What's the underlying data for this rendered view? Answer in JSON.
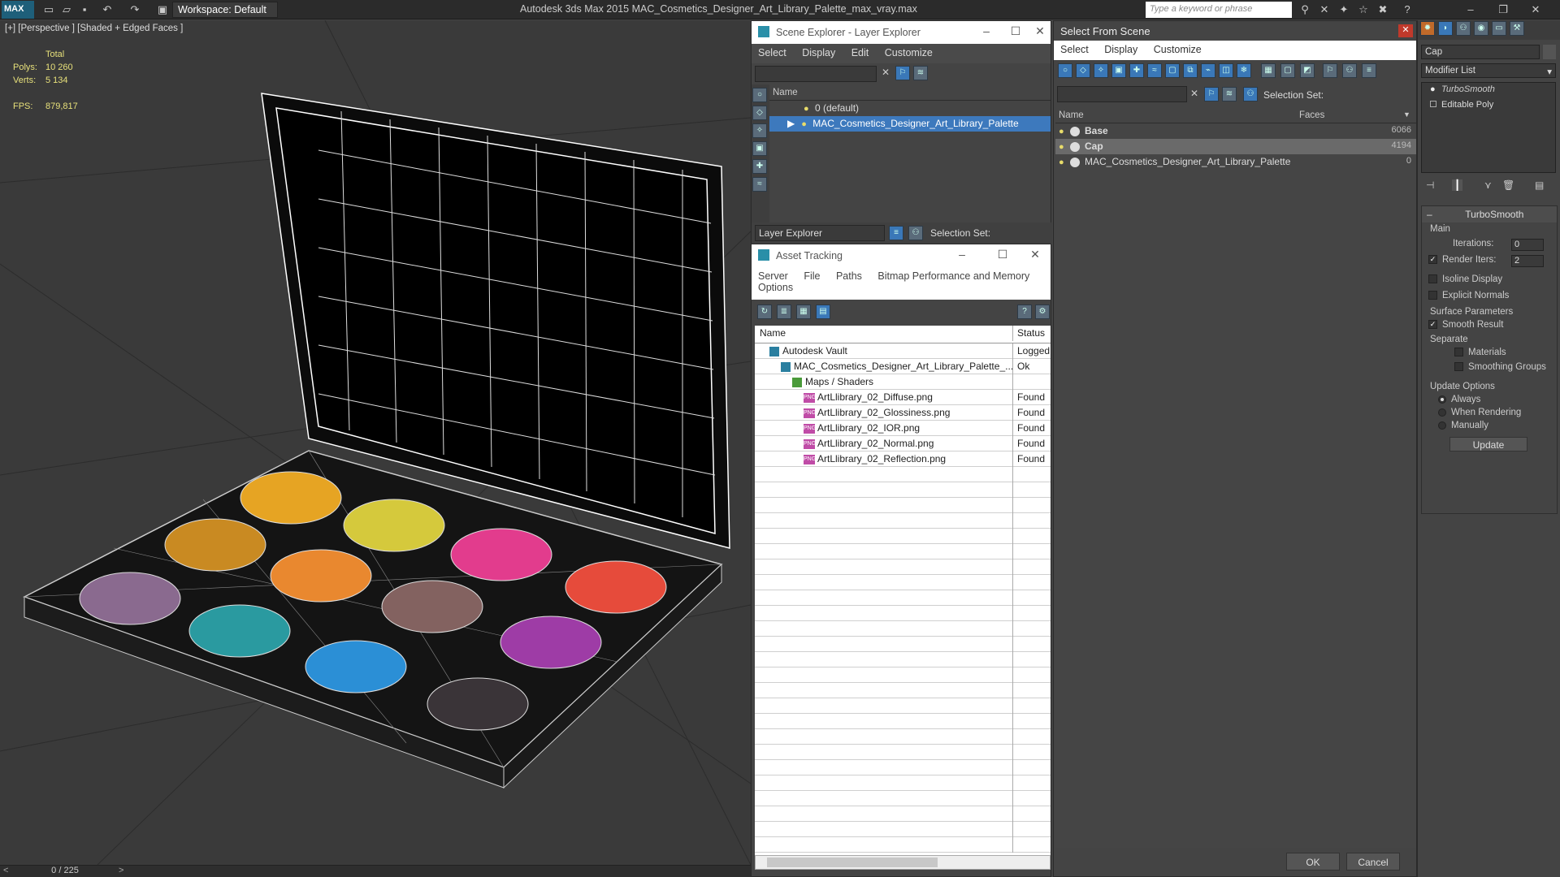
{
  "app": {
    "logo": "MAX",
    "workspace": "Workspace: Default",
    "title": "Autodesk 3ds Max  2015    MAC_Cosmetics_Designer_Art_Library_Palette_max_vray.max",
    "search_placeholder": "Type a keyword or phrase"
  },
  "viewport": {
    "label": "[+] [Perspective ] [Shaded + Edged Faces ]",
    "stats": {
      "total_label": "Total",
      "polys_label": "Polys:",
      "polys": "10 260",
      "verts_label": "Verts:",
      "verts": "5 134",
      "fps_label": "FPS:",
      "fps": "879,817"
    },
    "timeline": "0 / 225",
    "swatches": [
      "#e6a423",
      "#d5c93c",
      "#c98a22",
      "#e9882f",
      "#e23c8d",
      "#e64b3b",
      "#8a6a8f",
      "#2a9aa0",
      "#836260",
      "#9e3ca6",
      "#2b8fd6",
      "#3a3438"
    ]
  },
  "scene_explorer": {
    "title": "Scene Explorer - Layer Explorer",
    "menu": [
      "Select",
      "Display",
      "Edit",
      "Customize"
    ],
    "col_name": "Name",
    "rows": [
      {
        "label": "0 (default)",
        "selected": false
      },
      {
        "label": "MAC_Cosmetics_Designer_Art_Library_Palette",
        "selected": true
      }
    ],
    "footer_dropdown": "Layer Explorer",
    "selection_set": "Selection Set:"
  },
  "asset_tracking": {
    "title": "Asset Tracking",
    "menu": [
      "Server",
      "File",
      "Paths",
      "Bitmap Performance and Memory"
    ],
    "menu2": [
      "Options"
    ],
    "col_name": "Name",
    "col_status": "Status",
    "rows": [
      {
        "name": "Autodesk Vault",
        "status": "Logged",
        "indent": 1
      },
      {
        "name": "MAC_Cosmetics_Designer_Art_Library_Palette_...",
        "status": "Ok",
        "indent": 2
      },
      {
        "name": "Maps / Shaders",
        "status": "",
        "indent": 3
      },
      {
        "name": "ArtLlibrary_02_Diffuse.png",
        "status": "Found",
        "indent": 4
      },
      {
        "name": "ArtLlibrary_02_Glossiness.png",
        "status": "Found",
        "indent": 4
      },
      {
        "name": "ArtLlibrary_02_IOR.png",
        "status": "Found",
        "indent": 4
      },
      {
        "name": "ArtLlibrary_02_Normal.png",
        "status": "Found",
        "indent": 4
      },
      {
        "name": "ArtLlibrary_02_Reflection.png",
        "status": "Found",
        "indent": 4
      }
    ]
  },
  "select_from_scene": {
    "title": "Select From Scene",
    "menu": [
      "Select",
      "Display",
      "Customize"
    ],
    "selection_set": "Selection Set:",
    "col_name": "Name",
    "col_faces": "Faces",
    "rows": [
      {
        "name": "Base",
        "faces": "6066",
        "selected": false,
        "bold": true
      },
      {
        "name": "Cap",
        "faces": "4194",
        "selected": true,
        "bold": true
      },
      {
        "name": "MAC_Cosmetics_Designer_Art_Library_Palette",
        "faces": "0",
        "selected": false,
        "bold": false
      }
    ],
    "ok": "OK",
    "cancel": "Cancel"
  },
  "command_panel": {
    "object_name": "Cap",
    "modifier_list": "Modifier List",
    "stack": [
      "TurboSmooth",
      "Editable Poly"
    ],
    "rollout_title": "TurboSmooth",
    "main_label": "Main",
    "iterations_label": "Iterations:",
    "iterations": "0",
    "render_iters_label": "Render Iters:",
    "render_iters": "2",
    "isoline": "Isoline Display",
    "explicit_normals": "Explicit Normals",
    "surface_params": "Surface Parameters",
    "smooth_result": "Smooth Result",
    "separate": "Separate",
    "materials": "Materials",
    "smoothing_groups": "Smoothing Groups",
    "update_options": "Update Options",
    "always": "Always",
    "when_rendering": "When Rendering",
    "manually": "Manually",
    "update": "Update"
  }
}
